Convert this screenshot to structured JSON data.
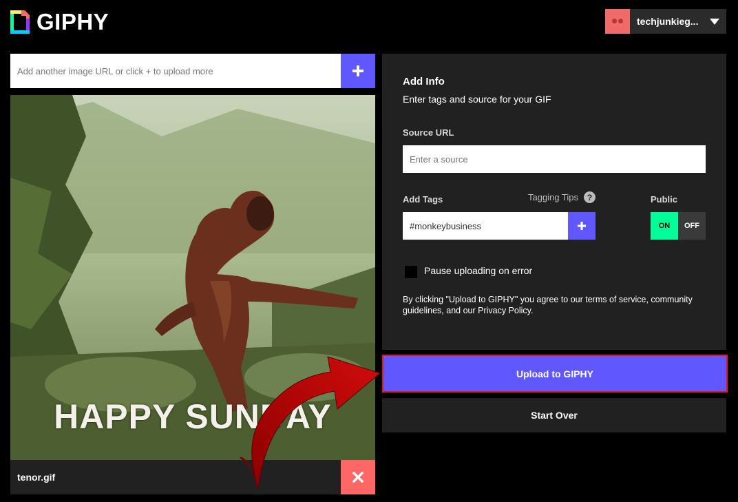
{
  "brand": {
    "name": "GIPHY"
  },
  "user": {
    "username": "techjunkieg..."
  },
  "upload": {
    "url_placeholder": "Add another image URL or click + to upload more",
    "gif_caption": "HAPPY SUNDAY",
    "file_name": "tenor.gif"
  },
  "info": {
    "title": "Add Info",
    "subtitle": "Enter tags and source for your GIF",
    "source_label": "Source URL",
    "source_placeholder": "Enter a source",
    "tags_label": "Add Tags",
    "tagging_tips": "Tagging Tips",
    "tags_value": "#monkeybusiness",
    "public_label": "Public",
    "toggle_on": "ON",
    "toggle_off": "OFF",
    "public_state": "on",
    "pause_label": "Pause uploading on error",
    "terms": "By clicking \"Upload to GIPHY\" you agree to our terms of service, community guidelines, and our Privacy Policy."
  },
  "actions": {
    "upload_label": "Upload to GIPHY",
    "start_over_label": "Start Over"
  },
  "colors": {
    "accent": "#6157ff",
    "toggle_on": "#00ff99",
    "remove": "#ff6666",
    "highlight_border": "#e8141b",
    "panel": "#212121"
  }
}
